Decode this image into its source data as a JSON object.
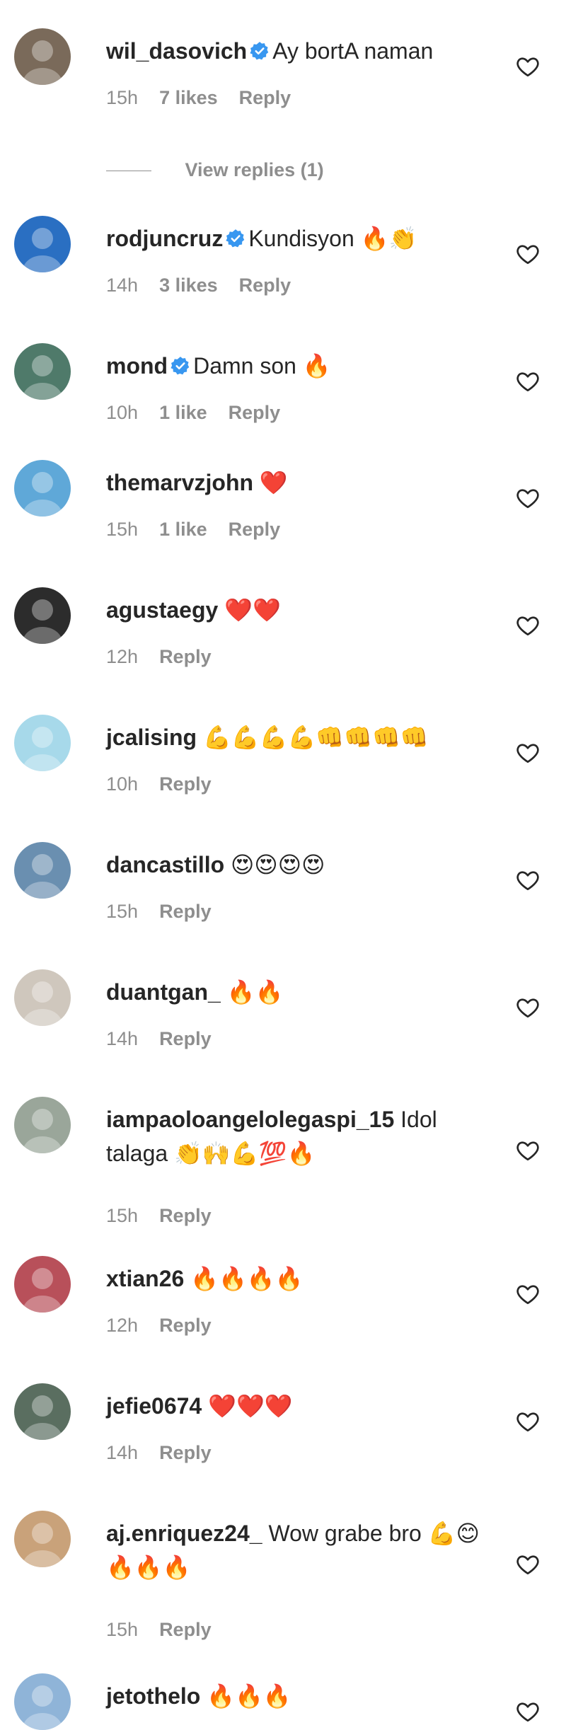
{
  "comments": [
    {
      "username": "wil_dasovich",
      "verified": true,
      "text": "Ay bortA naman",
      "time": "15h",
      "likes": "7 likes",
      "reply": "Reply",
      "avatar_color": "#7a6a5a"
    },
    {
      "username": "rodjuncruz",
      "verified": true,
      "text": "Kundisyon 🔥👏",
      "time": "14h",
      "likes": "3 likes",
      "reply": "Reply",
      "avatar_color": "#2a6fc2"
    },
    {
      "username": "mond",
      "verified": true,
      "text": "Damn son 🔥",
      "time": "10h",
      "likes": "1 like",
      "reply": "Reply",
      "avatar_color": "#4f7a6a"
    },
    {
      "username": "themarvzjohn",
      "verified": false,
      "text": "❤️",
      "time": "15h",
      "likes": "1 like",
      "reply": "Reply",
      "avatar_color": "#5fa8d8"
    },
    {
      "username": "agustaegy",
      "verified": false,
      "text": "❤️❤️",
      "time": "12h",
      "likes": "",
      "reply": "Reply",
      "avatar_color": "#2c2c2c"
    },
    {
      "username": "jcalising",
      "verified": false,
      "text": "💪💪💪💪👊👊👊👊",
      "time": "10h",
      "likes": "",
      "reply": "Reply",
      "avatar_color": "#a7d9ea"
    },
    {
      "username": "dancastillo",
      "verified": false,
      "text": "😍😍😍😍",
      "time": "15h",
      "likes": "",
      "reply": "Reply",
      "avatar_color": "#6a8fb0"
    },
    {
      "username": "duantgan_",
      "verified": false,
      "text": "🔥🔥",
      "time": "14h",
      "likes": "",
      "reply": "Reply",
      "avatar_color": "#cfc7bd"
    },
    {
      "username": "iampaoloangelolegaspi_15",
      "verified": false,
      "text": "Idol talaga 👏🙌💪💯🔥",
      "time": "15h",
      "likes": "",
      "reply": "Reply",
      "avatar_color": "#9aa69a"
    },
    {
      "username": "xtian26",
      "verified": false,
      "text": "🔥🔥🔥🔥",
      "time": "12h",
      "likes": "",
      "reply": "Reply",
      "avatar_color": "#b8505a"
    },
    {
      "username": "jefie0674",
      "verified": false,
      "text": "❤️❤️❤️",
      "time": "14h",
      "likes": "",
      "reply": "Reply",
      "avatar_color": "#5a6e60"
    },
    {
      "username": "aj.enriquez24_",
      "verified": false,
      "text": "Wow grabe bro 💪😊🔥🔥🔥",
      "time": "15h",
      "likes": "",
      "reply": "Reply",
      "avatar_color": "#c9a27a"
    },
    {
      "username": "jetothelo",
      "verified": false,
      "text": "🔥🔥🔥",
      "time": "",
      "likes": "",
      "reply": "",
      "avatar_color": "#8fb4d8"
    }
  ],
  "view_replies": "View replies (1)",
  "icons": {
    "like": "heart-outline-icon",
    "verified": "verified-badge-icon"
  },
  "colors": {
    "verified": "#3897f0",
    "meta": "#8e8e8e",
    "text": "#262626"
  }
}
